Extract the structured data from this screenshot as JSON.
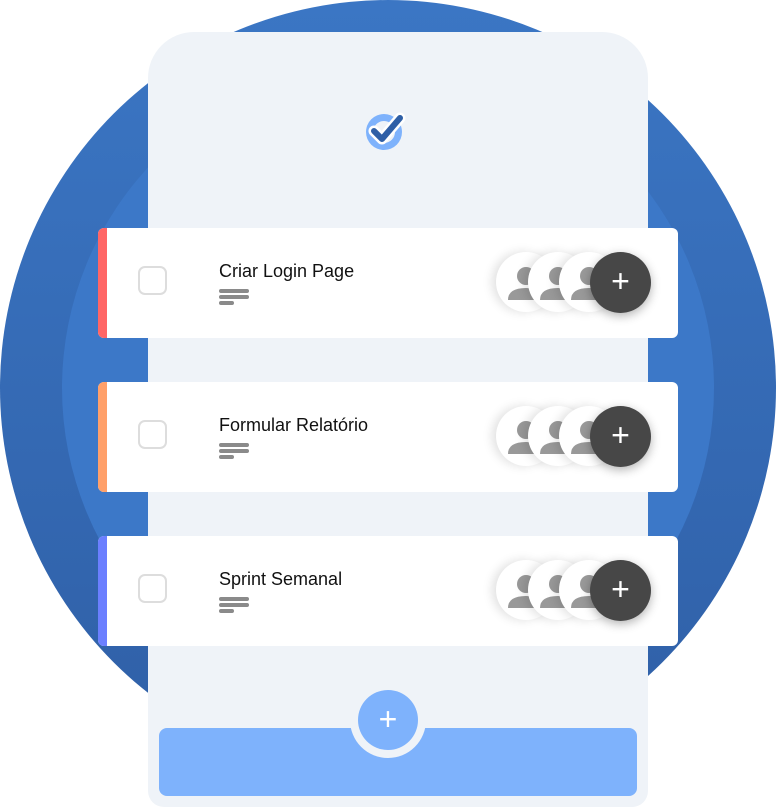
{
  "tasks": [
    {
      "title": "Criar Login Page",
      "color": "#ff6666"
    },
    {
      "title": "Formular Relatório",
      "color": "#ffa06a"
    },
    {
      "title": "Sprint Semanal",
      "color": "#6b7fff"
    }
  ],
  "add_member_label": "+",
  "add_task_label": "+"
}
